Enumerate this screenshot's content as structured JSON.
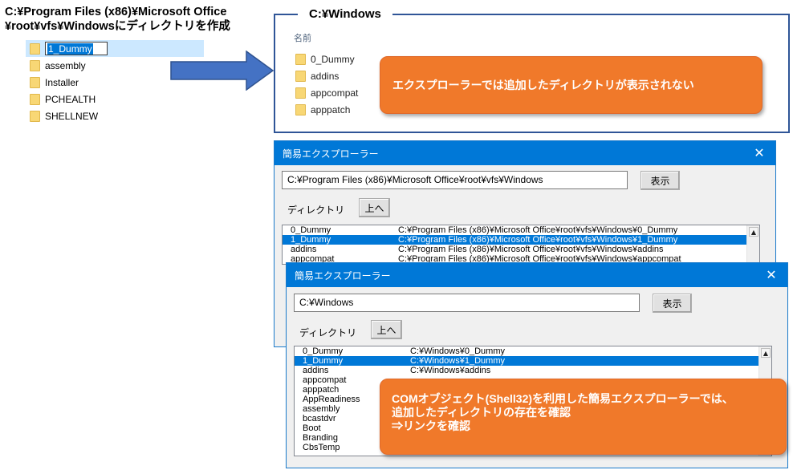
{
  "heading": {
    "line1": "C:¥Program Files (x86)¥Microsoft Office",
    "line2": "¥root¥vfs¥Windowsにディレクトリを作成"
  },
  "vfs_tree": {
    "rename_value": "1_Dummy",
    "items": [
      "assembly",
      "Installer",
      "PCHEALTH",
      "SHELLNEW"
    ]
  },
  "explorer": {
    "title": "C:¥Windows",
    "column_header": "名前",
    "items": [
      "0_Dummy",
      "addins",
      "appcompat",
      "apppatch"
    ]
  },
  "callouts": {
    "explorer_note": "エクスプローラーでは追加したディレクトリが表示されない",
    "com_note": [
      "COMオブジェクト(Shell32)を利用した簡易エクスプローラーでは、",
      "追加したディレクトリの存在を確認",
      "⇒リンクを確認"
    ]
  },
  "dialog1": {
    "title": "簡易エクスプローラー",
    "path": "C:¥Program Files (x86)¥Microsoft Office¥root¥vfs¥Windows",
    "show_button": "表示",
    "dir_label": "ディレクトリ",
    "up_button": "上へ",
    "rows": [
      {
        "name": "0_Dummy",
        "path": "C:¥Program Files (x86)¥Microsoft Office¥root¥vfs¥Windows¥0_Dummy",
        "selected": false
      },
      {
        "name": "1_Dummy",
        "path": "C:¥Program Files (x86)¥Microsoft Office¥root¥vfs¥Windows¥1_Dummy",
        "selected": true
      },
      {
        "name": "addins",
        "path": "C:¥Program Files (x86)¥Microsoft Office¥root¥vfs¥Windows¥addins",
        "selected": false
      },
      {
        "name": "appcompat",
        "path": "C:¥Program Files (x86)¥Microsoft Office¥root¥vfs¥Windows¥appcompat",
        "selected": false
      }
    ]
  },
  "dialog2": {
    "title": "簡易エクスプローラー",
    "path": "C:¥Windows",
    "show_button": "表示",
    "dir_label": "ディレクトリ",
    "up_button": "上へ",
    "rows": [
      {
        "name": "0_Dummy",
        "path": "C:¥Windows¥0_Dummy",
        "selected": false
      },
      {
        "name": "1_Dummy",
        "path": "C:¥Windows¥1_Dummy",
        "selected": true
      },
      {
        "name": "addins",
        "path": "C:¥Windows¥addins",
        "selected": false
      },
      {
        "name": "appcompat",
        "path": "",
        "selected": false
      },
      {
        "name": "apppatch",
        "path": "",
        "selected": false
      },
      {
        "name": "AppReadiness",
        "path": "",
        "selected": false
      },
      {
        "name": "assembly",
        "path": "",
        "selected": false
      },
      {
        "name": "bcastdvr",
        "path": "",
        "selected": false
      },
      {
        "name": "Boot",
        "path": "",
        "selected": false
      },
      {
        "name": "Branding",
        "path": "",
        "selected": false
      },
      {
        "name": "CbsTemp",
        "path": "",
        "selected": false
      }
    ]
  },
  "colors": {
    "accent_orange": "#f0792a",
    "arrow_blue": "#4472c4",
    "frame_blue": "#2f5597",
    "titlebar_blue": "#0078d7",
    "selection_blue": "#0078d7",
    "folder_yellow": "#f8d775"
  },
  "icons": {
    "folder": "folder-icon",
    "arrow": "right-arrow",
    "close": "close-icon",
    "scroll_up": "scroll-up-arrow"
  }
}
